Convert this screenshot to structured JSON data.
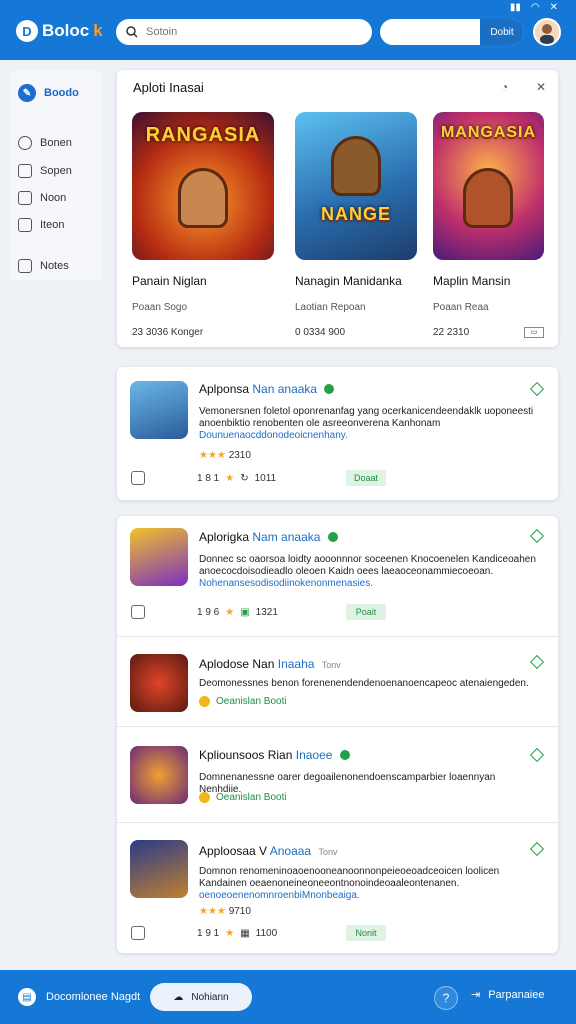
{
  "header": {
    "logo_text": "Boloc",
    "logo_accent": "k",
    "search_placeholder": "Sotoin",
    "search_button": "Dobit",
    "status_icons": [
      "signal-icon",
      "wifi-icon",
      "close-icon"
    ]
  },
  "sidebar": {
    "items": [
      {
        "label": "Boodo",
        "icon": "pen-icon",
        "active": true
      },
      {
        "label": "Bonen",
        "icon": "clock-icon"
      },
      {
        "label": "Sopen",
        "icon": "list-icon"
      },
      {
        "label": "Noon",
        "icon": "bookmark-icon"
      },
      {
        "label": "Iteon",
        "icon": "image-icon"
      },
      {
        "label": "Notes",
        "icon": "notes-icon"
      }
    ]
  },
  "featured": {
    "title": "Aploti Inasai",
    "games": [
      {
        "art_title": "RANGASIA",
        "name": "Panain Niglan",
        "sub": "Poaan Sogo",
        "meta": "23 3036 Konger"
      },
      {
        "art_title": "NANGE",
        "name": "Nanagin Manidanka",
        "sub": "Laotian Repoan",
        "meta": "0 0334 900"
      },
      {
        "art_title": "MANGASIA",
        "name": "Maplin Mansin",
        "sub": "Poaan Reaa",
        "meta": "22 2310"
      }
    ]
  },
  "apps": [
    {
      "title": "Aplponsa",
      "title_hl": "Nan anaaka",
      "desc": "Vemonersnen foletol oponrenanfag yang ocerkanicendeendaklk uoponeesti anoenbiktio renobenten ole asreeonverena Kanhonam",
      "link": "Dounuenaocddonodeoicnenhany.",
      "stars": "★★★",
      "rating_count": "2310",
      "foot_rating": "1 8 1",
      "foot_count": "1011",
      "install": "Doaat"
    },
    {
      "title": "Aplorigka",
      "title_hl": "Nam anaaka",
      "desc": "Donnec sc oaorsoa loidty aooonnnor soceenen Knocoenelen Kandiceoahen anoecocdoisodieadlo oleoen Kaidn oees laeaoceonammiecoeoan.",
      "link": "Nohenansesodisodiinokenonmenasies.",
      "foot_rating": "1 9 6",
      "foot_count": "1321",
      "install": "Poait"
    },
    {
      "title": "Aplodose Nan",
      "title_hl": "Inaaha",
      "version": "Tonv",
      "desc": "Deomonessnes benon forenenendendenoenanoencapeoc atenaiengeden.",
      "badge": "Oeanislan Booti"
    },
    {
      "title": "Kpliounsoos Rian",
      "title_hl": "Inaoee",
      "desc": "Domnenanessne oarer degoailenonendoenscamparbier loaennyan Nenhdiie.",
      "badge": "Oeanislan Booti"
    },
    {
      "title": "Apploosaa V",
      "title_hl": "Anoaaa",
      "version": "Tonv",
      "desc": "Domnon renomeninoaoenooneanoonnonpeieoeoadceoicen loolicen Kandainen oeaenoneineoneeontnonoindeoaaleontenanen.",
      "link": "oenoeoenenomnroenbiMnonbeaiga.",
      "stars": "★★★",
      "rating_count": "9710",
      "foot_rating": "1 9 1",
      "foot_count": "1100",
      "install": "Nonit"
    }
  ],
  "bottom": {
    "left_label": "Docomlonee Nagdt",
    "pill_label": "Nohiann",
    "right_label": "Parpanaiee"
  }
}
